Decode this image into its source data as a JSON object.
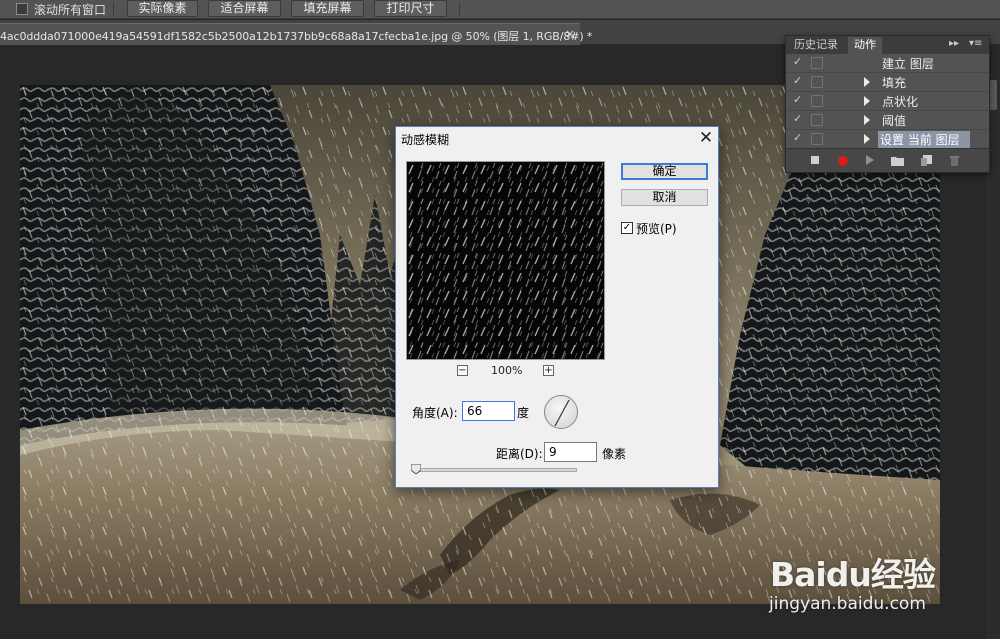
{
  "options_bar": {
    "scroll_all_windows_label": "滚动所有窗口",
    "buttons": [
      "实际像素",
      "适合屏幕",
      "填充屏幕",
      "打印尺寸"
    ]
  },
  "document_tab": {
    "title": "4ac0ddda071000e419a54591df1582c5b2500a12b1737bb9c68a8a17cfecba1e.jpg @ 50% (图层 1, RGB/8#) *",
    "close": "×"
  },
  "panel": {
    "tabs": [
      "历史记录",
      "动作"
    ],
    "active_tab": "动作",
    "menu_icons": [
      "▸▸",
      "▾≡"
    ],
    "actions": [
      {
        "check": "✓",
        "label": "建立 图层",
        "has_arrow": false
      },
      {
        "check": "✓",
        "label": "填充",
        "has_arrow": true
      },
      {
        "check": "✓",
        "label": "点状化",
        "has_arrow": true
      },
      {
        "check": "✓",
        "label": "阈值",
        "has_arrow": true
      },
      {
        "check": "✓",
        "label": "设置 当前 图层",
        "has_arrow": true,
        "selected": true
      }
    ],
    "bottom_icons": [
      "stop-icon",
      "record-icon",
      "play-icon",
      "folder-icon",
      "new-action-icon",
      "trash-icon"
    ],
    "record_color": "#e01a1a"
  },
  "dialog": {
    "title": "动感模糊",
    "close": "✕",
    "ok_label": "确定",
    "cancel_label": "取消",
    "preview_checkbox": "✓",
    "preview_label": "预览(P)",
    "zoom_minus": "−",
    "zoom_plus": "+",
    "zoom_percent": "100%",
    "angle_label": "角度(A):",
    "angle_value": "66",
    "angle_unit": "度",
    "distance_label": "距离(D):",
    "distance_value": "9",
    "distance_unit": "像素",
    "accent_color": "#3b7cd4"
  },
  "watermark": {
    "logo": "Baidu经验",
    "url": "jingyan.baidu.com"
  }
}
